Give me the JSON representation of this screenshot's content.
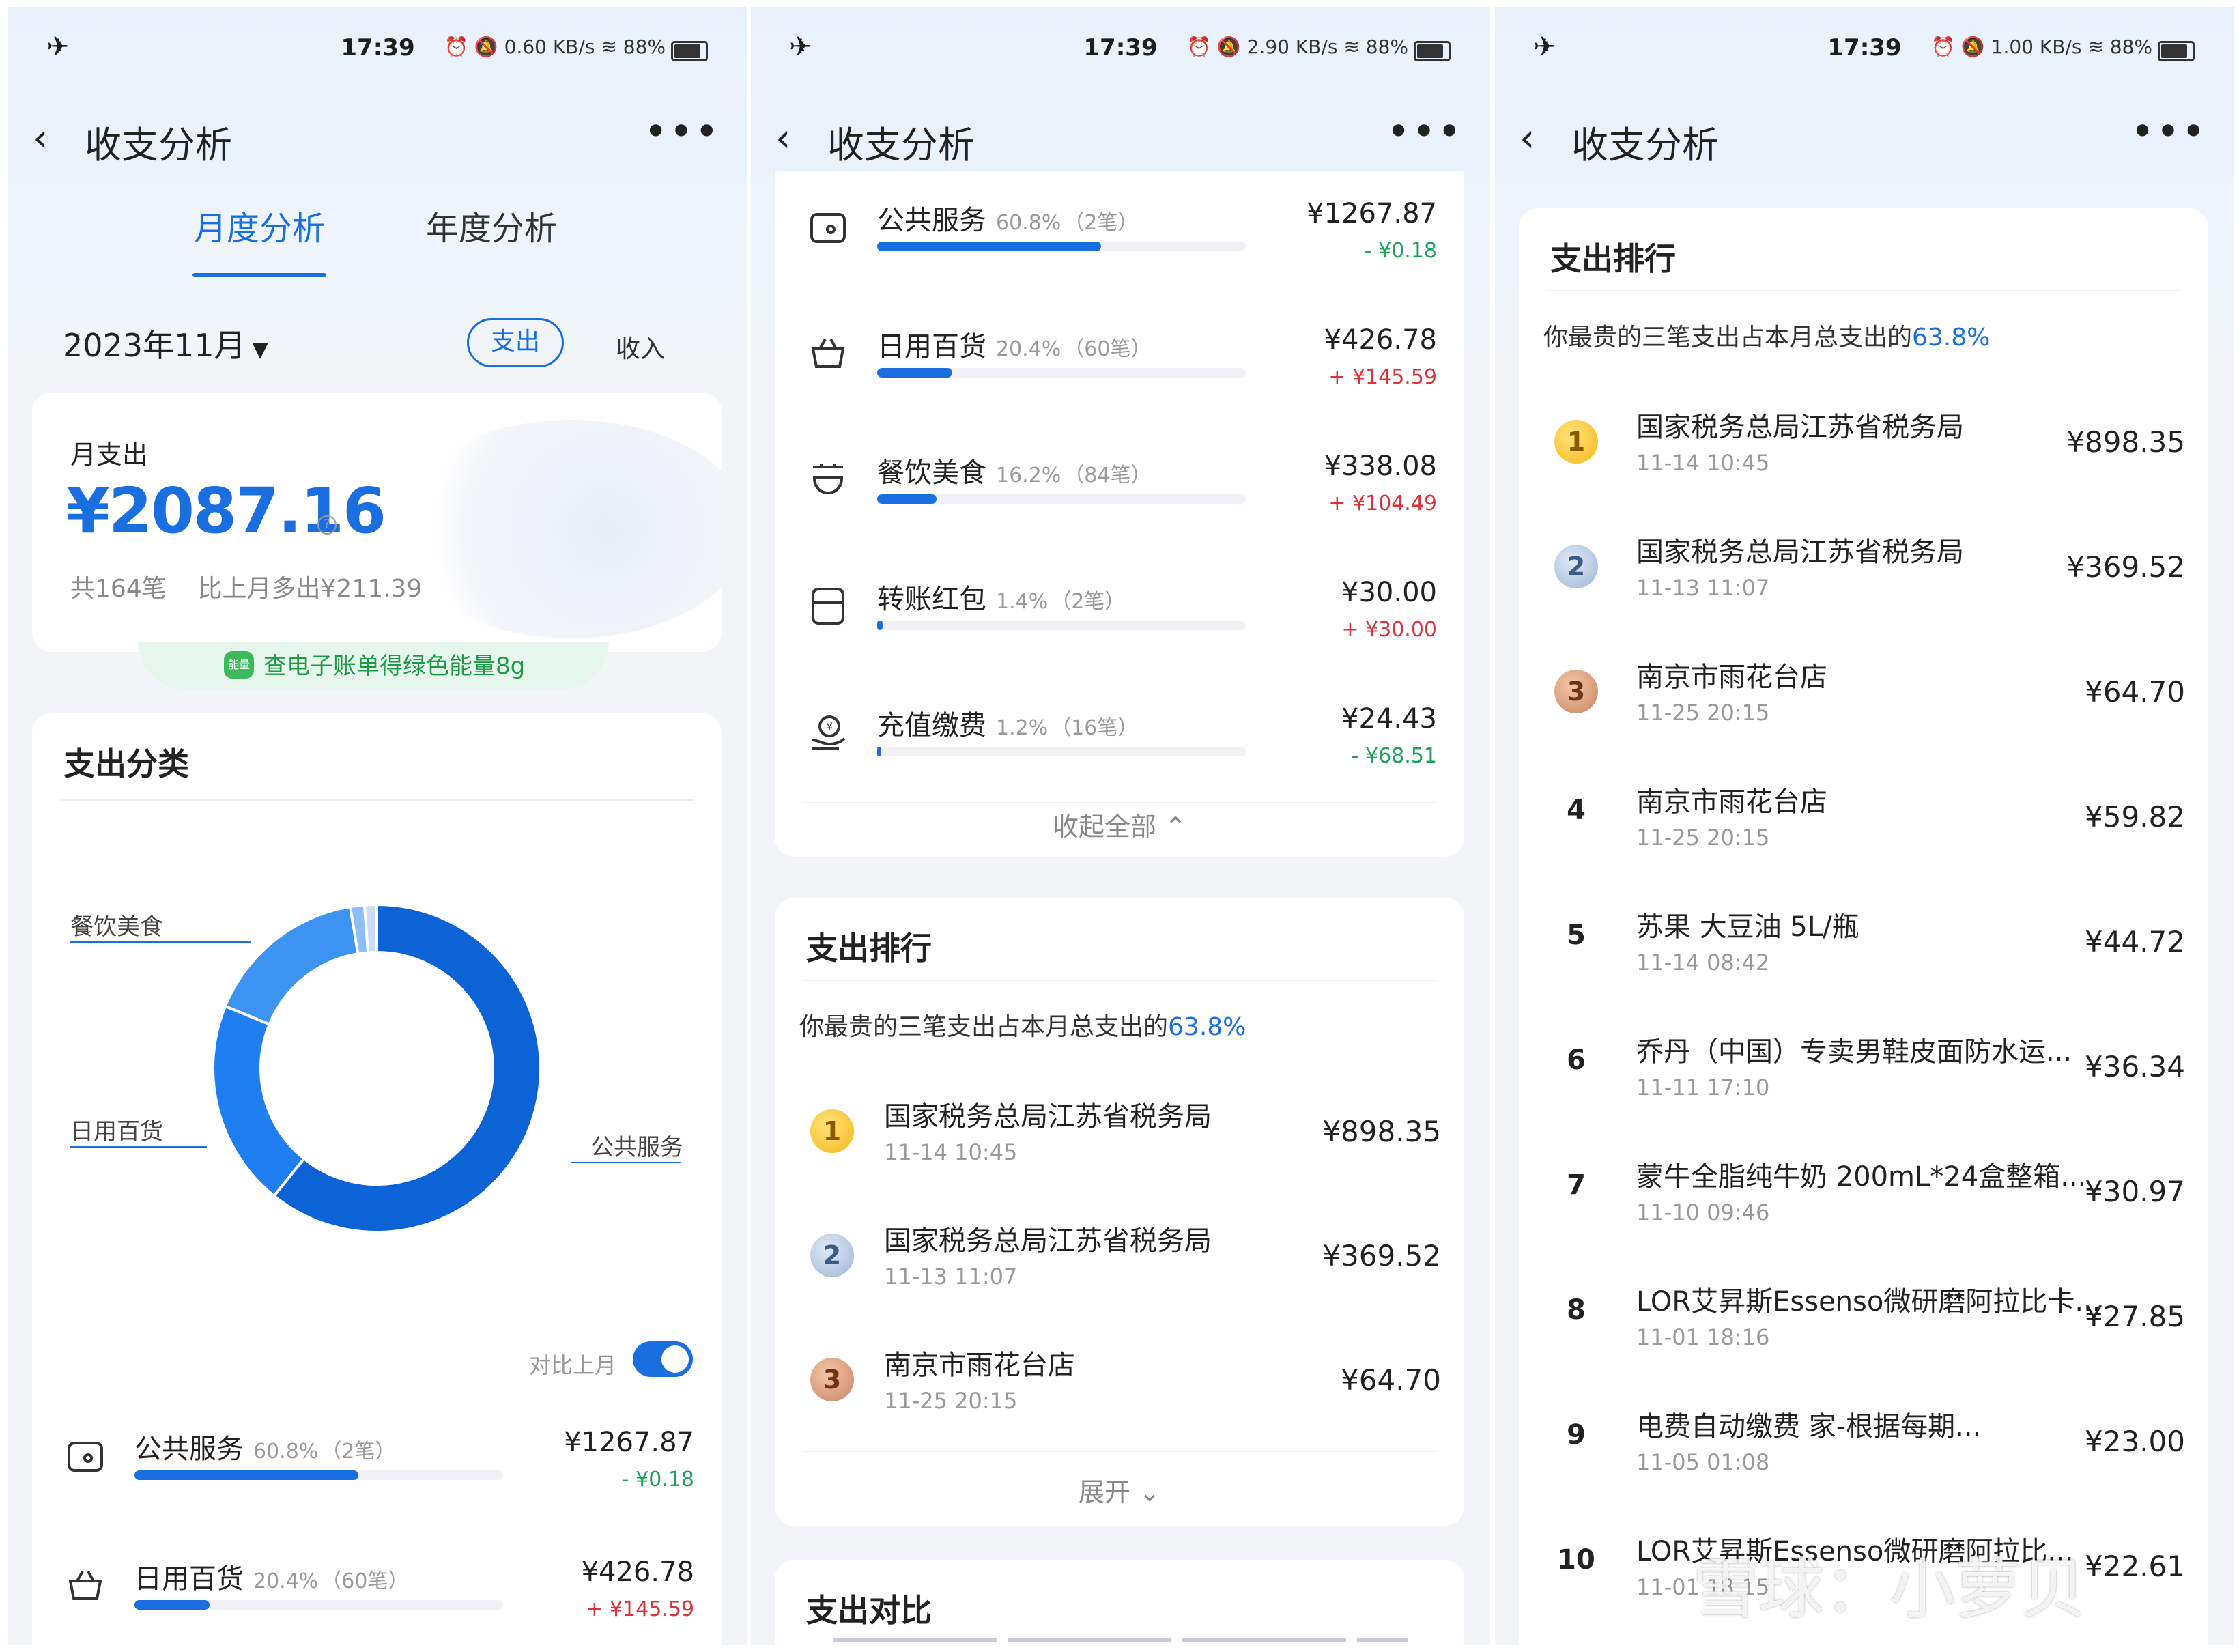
{
  "status": {
    "time": "17:39",
    "speeds": [
      "0.60",
      "2.90",
      "1.00"
    ],
    "speed_unit": "KB/s",
    "battery": "88%"
  },
  "nav": {
    "title": "收支分析"
  },
  "tabs": {
    "monthly": "月度分析",
    "yearly": "年度分析"
  },
  "filter": {
    "month": "2023年11月",
    "expense": "支出",
    "income": "收入"
  },
  "summary": {
    "label": "月支出",
    "amount": "¥2087.16",
    "count": "共164笔",
    "compare": "比上月多出¥211.39"
  },
  "banner": {
    "badge": "能量",
    "text": "查电子账单得绿色能量8g"
  },
  "categories_title": "支出分类",
  "donut": {
    "label_food": "餐饮美食",
    "label_daily": "日用百货",
    "label_public": "公共服务"
  },
  "compare_toggle": "对比上月",
  "collapse": "收起全部",
  "expand": "展开",
  "categories": [
    {
      "name": "公共服务",
      "pct": "60.8%",
      "count": "（2笔）",
      "amount": "¥1267.87",
      "diff": "- ¥0.18",
      "bar": 60.8,
      "icon": "wallet-icon"
    },
    {
      "name": "日用百货",
      "pct": "20.4%",
      "count": "（60笔）",
      "amount": "¥426.78",
      "diff": "+ ¥145.59",
      "bar": 20.4,
      "icon": "basket-icon"
    },
    {
      "name": "餐饮美食",
      "pct": "16.2%",
      "count": "（84笔）",
      "amount": "¥338.08",
      "diff": "+ ¥104.49",
      "bar": 16.2,
      "icon": "bowl-icon"
    },
    {
      "name": "转账红包",
      "pct": "1.4%",
      "count": "（2笔）",
      "amount": "¥30.00",
      "diff": "+ ¥30.00",
      "bar": 1.4,
      "icon": "envelope-icon"
    },
    {
      "name": "充值缴费",
      "pct": "1.2%",
      "count": "（16笔）",
      "amount": "¥24.43",
      "diff": "- ¥68.51",
      "bar": 1.2,
      "icon": "coin-hand-icon"
    }
  ],
  "ranking": {
    "title": "支出排行",
    "subtitle_prefix": "你最贵的三笔支出占本月总支出的",
    "subtitle_pct": "63.8%",
    "items": [
      {
        "rank": "1",
        "name": "国家税务总局江苏省税务局",
        "date": "11-14 10:45",
        "amount": "¥898.35"
      },
      {
        "rank": "2",
        "name": "国家税务总局江苏省税务局",
        "date": "11-13 11:07",
        "amount": "¥369.52"
      },
      {
        "rank": "3",
        "name": "南京市雨花台店",
        "date": "11-25 20:15",
        "amount": "¥64.70"
      },
      {
        "rank": "4",
        "name": "南京市雨花台店",
        "date": "11-25 20:15",
        "amount": "¥59.82"
      },
      {
        "rank": "5",
        "name": "苏果 大豆油 5L/瓶",
        "date": "11-14 08:42",
        "amount": "¥44.72"
      },
      {
        "rank": "6",
        "name": "乔丹（中国）专卖男鞋皮面防水运...",
        "date": "11-11 17:10",
        "amount": "¥36.34"
      },
      {
        "rank": "7",
        "name": "蒙牛全脂纯牛奶 200mL*24盒整箱...",
        "date": "11-10 09:46",
        "amount": "¥30.97"
      },
      {
        "rank": "8",
        "name": "LOR艾昇斯Essenso微研磨阿拉比卡...",
        "date": "11-01 18:16",
        "amount": "¥27.85"
      },
      {
        "rank": "9",
        "name": "电费自动缴费                家-根据每期...",
        "date": "11-05 01:08",
        "amount": "¥23.00"
      },
      {
        "rank": "10",
        "name": "LOR艾昇斯Essenso微研磨阿拉比...",
        "date": "11-01 18:15",
        "amount": "¥22.61"
      }
    ]
  },
  "compare_title": "支出对比",
  "watermark": "雪球：小萝贝",
  "colors": {
    "accent": "#1a6fe0",
    "donut": [
      "#0b63d6",
      "#1f7ff0",
      "#3d93f2",
      "#8fbdf6",
      "#c9dcf8"
    ]
  }
}
